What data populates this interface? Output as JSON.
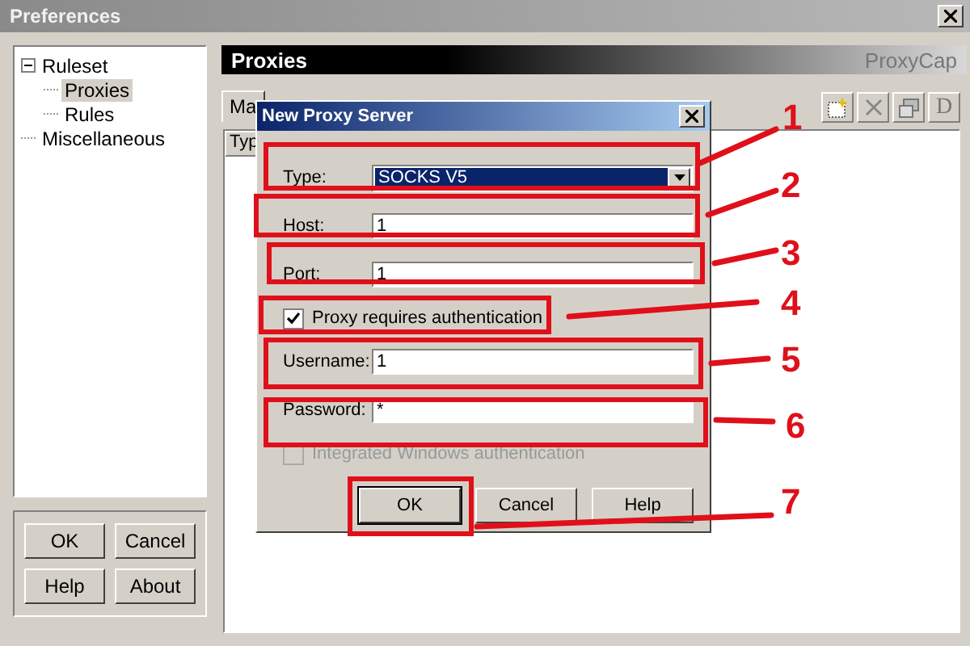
{
  "window": {
    "title": "Preferences"
  },
  "tree": [
    {
      "label": "Ruleset",
      "expanded": true,
      "selected": false,
      "children": [
        {
          "label": "Proxies",
          "selected": true
        },
        {
          "label": "Rules",
          "selected": false
        }
      ]
    },
    {
      "label": "Miscellaneous",
      "selected": false
    }
  ],
  "footer_buttons": [
    "OK",
    "Cancel",
    "Help",
    "About"
  ],
  "panel": {
    "title": "Proxies",
    "brand": "ProxyCap",
    "tab": "Ma",
    "column": "Typ",
    "toolbar_label": "D"
  },
  "dialog": {
    "title": "New Proxy Server",
    "fields": [
      {
        "kind": "select",
        "label": "Type:",
        "value": "SOCKS V5"
      },
      {
        "kind": "text",
        "label": "Host:",
        "value": "1"
      },
      {
        "kind": "text",
        "label": "Port:",
        "value": "1"
      },
      {
        "kind": "checkbox",
        "label": "Proxy requires authentication",
        "checked": true,
        "disabled": false
      },
      {
        "kind": "text",
        "label": "Username:",
        "value": "1"
      },
      {
        "kind": "text",
        "label": "Password:",
        "value": "*"
      },
      {
        "kind": "checkbox",
        "label": "Integrated Windows authentication",
        "checked": false,
        "disabled": true
      }
    ],
    "buttons": [
      {
        "label": "OK",
        "default": true
      },
      {
        "label": "Cancel",
        "default": false
      },
      {
        "label": "Help",
        "default": false
      }
    ]
  },
  "annotations": [
    "1",
    "2",
    "3",
    "4",
    "5",
    "6",
    "7"
  ]
}
